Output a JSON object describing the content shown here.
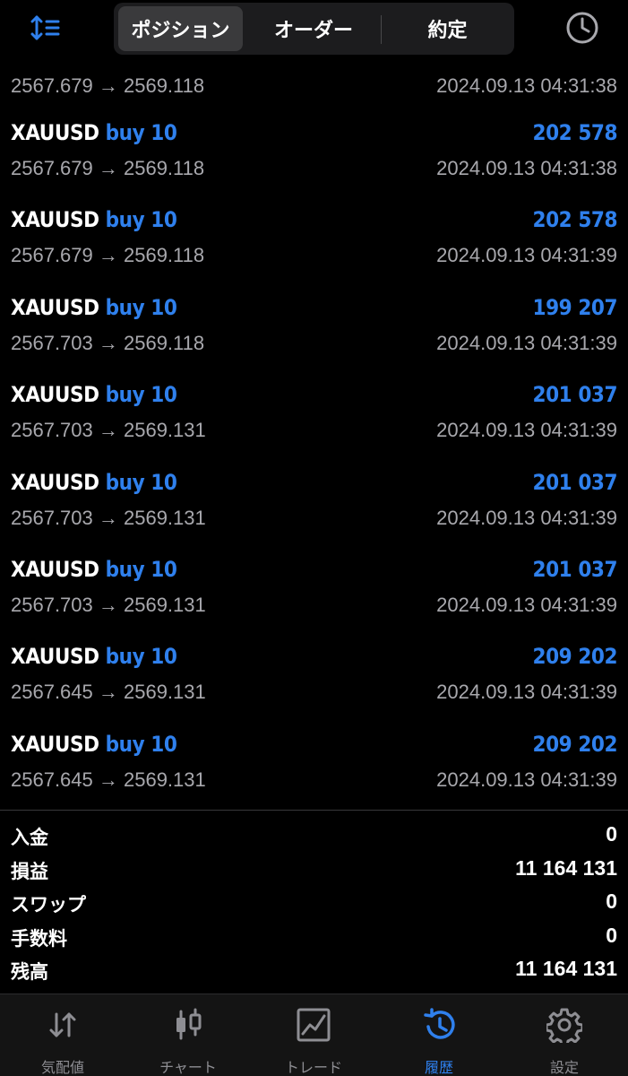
{
  "header": {
    "tabs": [
      {
        "label": "ポジション",
        "active": true
      },
      {
        "label": "オーダー",
        "active": false
      },
      {
        "label": "約定",
        "active": false
      }
    ],
    "sort_icon": "sort-icon",
    "clock_icon": "clock-icon"
  },
  "deals": [
    {
      "prices": "2567.679 → 2569.118",
      "time": "2024.09.13 04:31:38"
    },
    {
      "symbol": "XAUUSD",
      "side": "buy 10",
      "profit": "202 578",
      "prices": "2567.679 → 2569.118",
      "time": "2024.09.13 04:31:38"
    },
    {
      "symbol": "XAUUSD",
      "side": "buy 10",
      "profit": "202 578",
      "prices": "2567.679 → 2569.118",
      "time": "2024.09.13 04:31:39"
    },
    {
      "symbol": "XAUUSD",
      "side": "buy 10",
      "profit": "199 207",
      "prices": "2567.703 → 2569.118",
      "time": "2024.09.13 04:31:39"
    },
    {
      "symbol": "XAUUSD",
      "side": "buy 10",
      "profit": "201 037",
      "prices": "2567.703 → 2569.131",
      "time": "2024.09.13 04:31:39"
    },
    {
      "symbol": "XAUUSD",
      "side": "buy 10",
      "profit": "201 037",
      "prices": "2567.703 → 2569.131",
      "time": "2024.09.13 04:31:39"
    },
    {
      "symbol": "XAUUSD",
      "side": "buy 10",
      "profit": "201 037",
      "prices": "2567.703 → 2569.131",
      "time": "2024.09.13 04:31:39"
    },
    {
      "symbol": "XAUUSD",
      "side": "buy 10",
      "profit": "209 202",
      "prices": "2567.645 → 2569.131",
      "time": "2024.09.13 04:31:39"
    },
    {
      "symbol": "XAUUSD",
      "side": "buy 10",
      "profit": "209 202",
      "prices": "2567.645 → 2569.131",
      "time": "2024.09.13 04:31:39"
    }
  ],
  "summary": [
    {
      "label": "入金",
      "value": "0"
    },
    {
      "label": "損益",
      "value": "11 164 131"
    },
    {
      "label": "スワップ",
      "value": "0"
    },
    {
      "label": "手数料",
      "value": "0"
    },
    {
      "label": "残高",
      "value": "11 164 131"
    }
  ],
  "tabbar": [
    {
      "label": "気配値",
      "icon": "quotes-arrows-icon",
      "active": false
    },
    {
      "label": "チャート",
      "icon": "candlestick-chart-icon",
      "active": false
    },
    {
      "label": "トレード",
      "icon": "trade-chart-icon",
      "active": false
    },
    {
      "label": "履歴",
      "icon": "history-icon",
      "active": true
    },
    {
      "label": "設定",
      "icon": "gear-icon",
      "active": false
    }
  ],
  "colors": {
    "accent": "#2f80ed",
    "background": "#000000",
    "secondary_text": "#a8a8ad"
  }
}
